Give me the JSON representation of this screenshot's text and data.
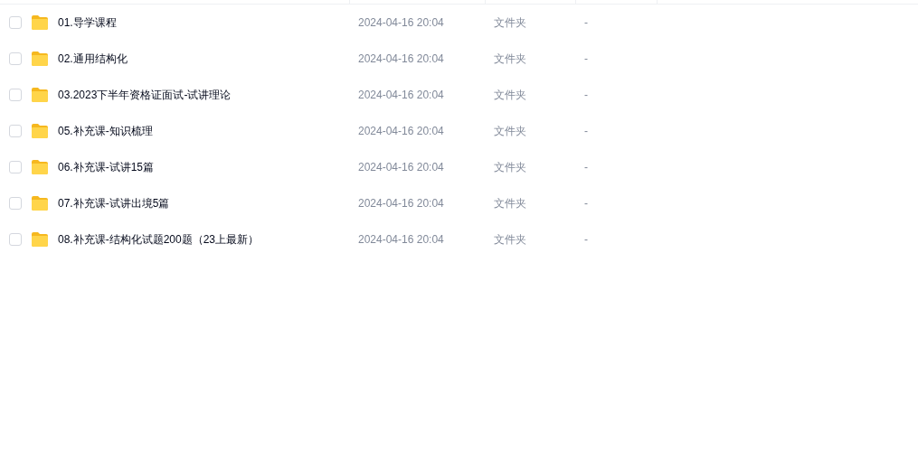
{
  "rows": [
    {
      "name": "01.导学课程",
      "modified": "2024-04-16 20:04",
      "type": "文件夹",
      "size": "-",
      "checked": false
    },
    {
      "name": "02.通用结构化",
      "modified": "2024-04-16 20:04",
      "type": "文件夹",
      "size": "-",
      "checked": false
    },
    {
      "name": "03.2023下半年资格证面试-试讲理论",
      "modified": "2024-04-16 20:04",
      "type": "文件夹",
      "size": "-",
      "checked": false
    },
    {
      "name": "05.补充课-知识梳理",
      "modified": "2024-04-16 20:04",
      "type": "文件夹",
      "size": "-",
      "checked": false
    },
    {
      "name": "06.补充课-试讲15篇",
      "modified": "2024-04-16 20:04",
      "type": "文件夹",
      "size": "-",
      "checked": false
    },
    {
      "name": "07.补充课-试讲出境5篇",
      "modified": "2024-04-16 20:04",
      "type": "文件夹",
      "size": "-",
      "checked": false
    },
    {
      "name": "08.补充课-结构化试题200题（23上最新）",
      "modified": "2024-04-16 20:04",
      "type": "文件夹",
      "size": "-",
      "checked": false
    }
  ]
}
